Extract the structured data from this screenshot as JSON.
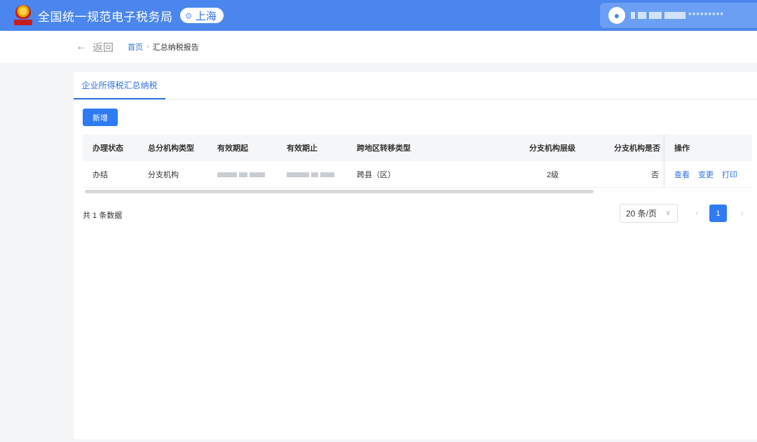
{
  "header": {
    "title": "全国统一规范电子税务局",
    "location": "上海",
    "user_masked": "*********",
    "brand_color": "#4a86ee"
  },
  "nav": {
    "back_label": "返回",
    "breadcrumb_home": "首页",
    "breadcrumb_sep": "›",
    "breadcrumb_current": "汇总纳税报告"
  },
  "tabs": [
    {
      "label": "企业所得税汇总纳税"
    }
  ],
  "toolbar": {
    "add_label": "新增"
  },
  "table": {
    "columns": [
      "办理状态",
      "总分机构类型",
      "有效期起",
      "有效期止",
      "跨地区转移类型",
      "分支机构层级",
      "分支机构是否",
      "操作"
    ],
    "rows": [
      {
        "status": "办结",
        "org_type": "分支机构",
        "transfer_type": "跨县（区）",
        "level": "2级",
        "is_flag": "否",
        "ops": [
          "查看",
          "变更",
          "打印"
        ]
      }
    ]
  },
  "pagination": {
    "total_text": "共 1 条数据",
    "page_size": "20 条/页",
    "current_page": "1"
  }
}
